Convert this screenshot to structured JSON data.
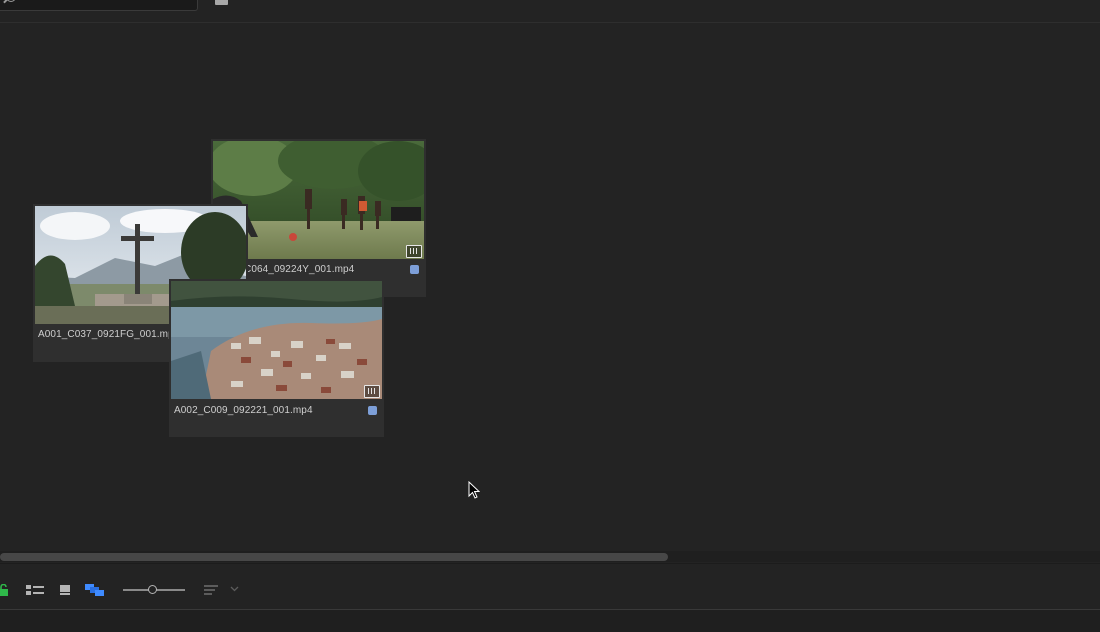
{
  "toolbar_top": {
    "search": {
      "placeholder": "",
      "icon": "search-icon"
    },
    "new_bin": {
      "icon": "new-bin-icon"
    }
  },
  "clips": [
    {
      "name": "C064_09224Y_001.mp4",
      "label_color": "#7d9fd8",
      "icon": "audio-video-icon"
    },
    {
      "name": "A001_C037_0921FG_001.mp4",
      "label_color": "#7d9fd8",
      "icon": "audio-video-icon"
    },
    {
      "name": "A002_C009_092221_001.mp4",
      "label_color": "#7d9fd8",
      "icon": "audio-video-icon"
    }
  ],
  "bottom_toolbar": {
    "icons": [
      "lock-icon",
      "list-view-icon",
      "icon-view-icon",
      "freeform-view-icon",
      "zoom-slider",
      "sort-icon",
      "chevron-down-icon"
    ],
    "active_view": "freeform-view-icon"
  }
}
